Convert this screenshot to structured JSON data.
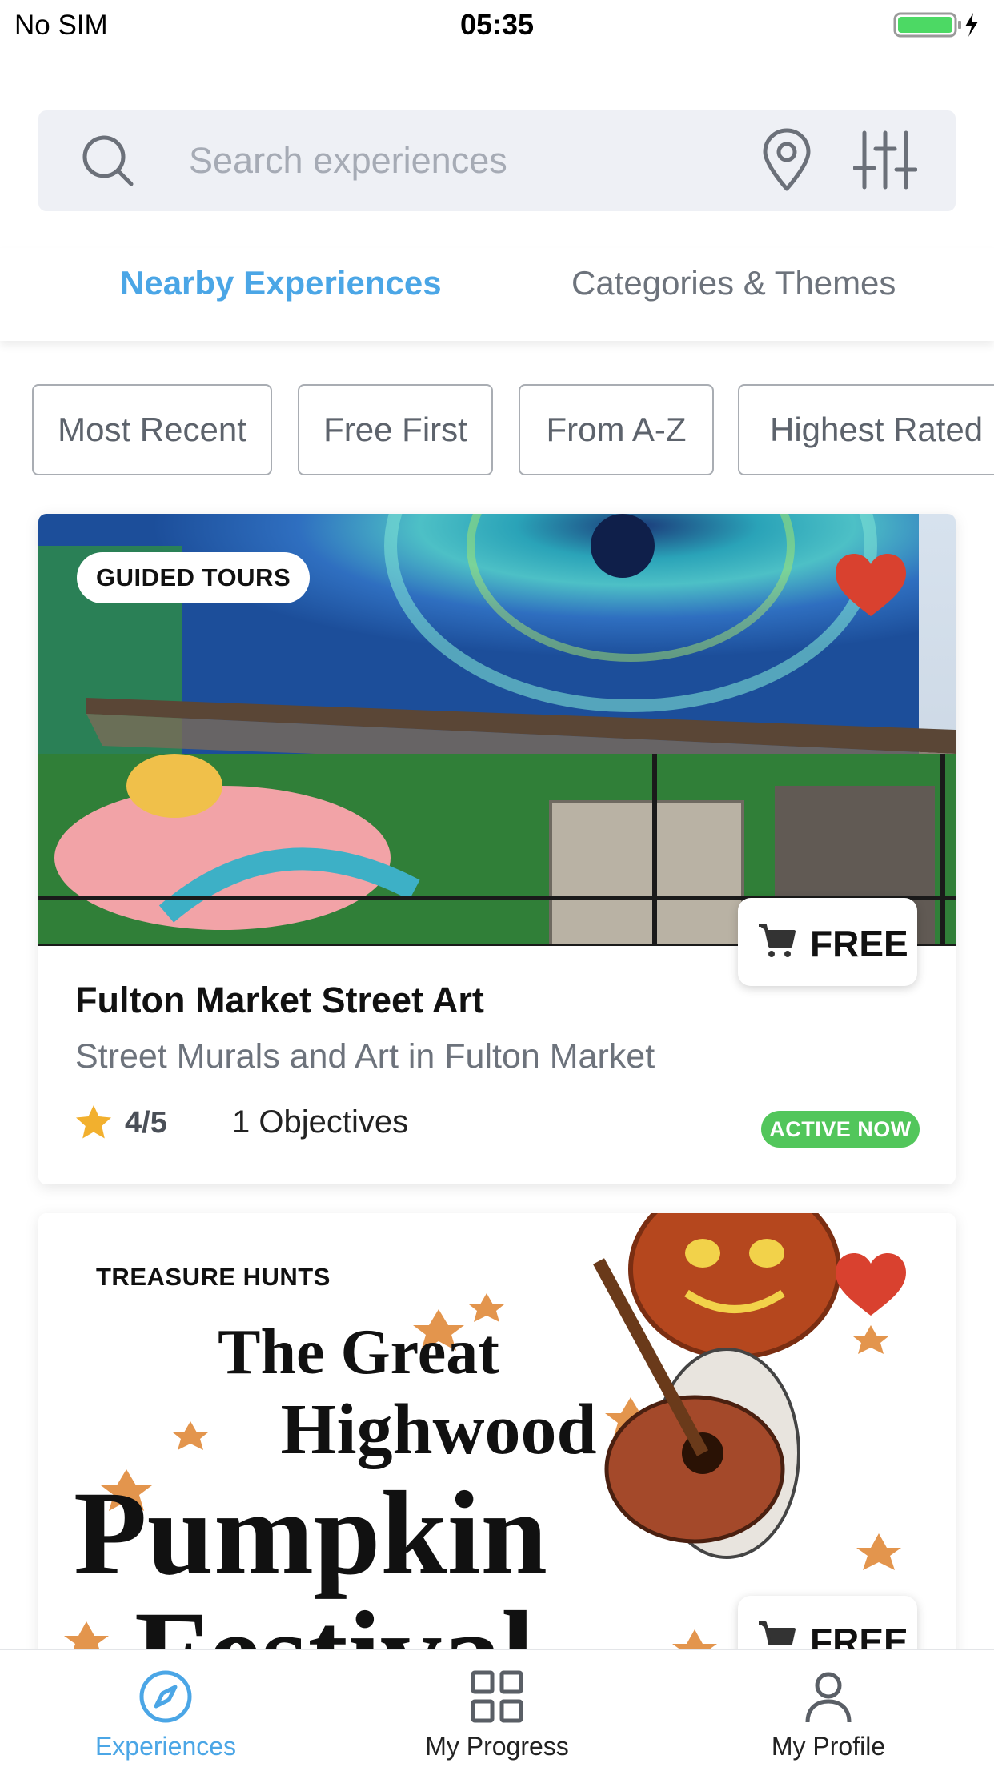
{
  "status_bar": {
    "carrier": "No SIM",
    "time": "05:35",
    "battery_icon": "battery-charging-icon"
  },
  "search": {
    "placeholder": "Search experiences",
    "value": "",
    "icons": [
      "search-icon",
      "location-pin-icon",
      "filter-sliders-icon"
    ]
  },
  "tabs": [
    {
      "label": "Nearby Experiences",
      "active": true
    },
    {
      "label": "Categories & Themes",
      "active": false
    }
  ],
  "sort_options": [
    {
      "label": "Most Recent"
    },
    {
      "label": "Free First"
    },
    {
      "label": "From A-Z"
    },
    {
      "label": "Highest Rated"
    }
  ],
  "cards": [
    {
      "category": "GUIDED TOURS",
      "favorited": true,
      "price": "FREE",
      "title": "Fulton Market Street Art",
      "subtitle": "Street Murals and Art in Fulton Market",
      "rating": "4/5",
      "objectives": "1 Objectives",
      "status": "ACTIVE NOW"
    },
    {
      "category": "TREASURE HUNTS",
      "favorited": true,
      "price": "FREE",
      "poster_lines": [
        "The Great",
        "Highwood",
        "Pumpkin",
        "Festival"
      ]
    }
  ],
  "bottom_nav": [
    {
      "label": "Experiences",
      "icon": "compass-icon",
      "active": true
    },
    {
      "label": "My Progress",
      "icon": "grid-icon",
      "active": false
    },
    {
      "label": "My Profile",
      "icon": "person-icon",
      "active": false
    }
  ],
  "colors": {
    "accent": "#4ba6e6",
    "active_badge": "#52c65b",
    "heart": "#d9412f",
    "star": "#f2b02e",
    "search_bg": "#eef0f5"
  }
}
